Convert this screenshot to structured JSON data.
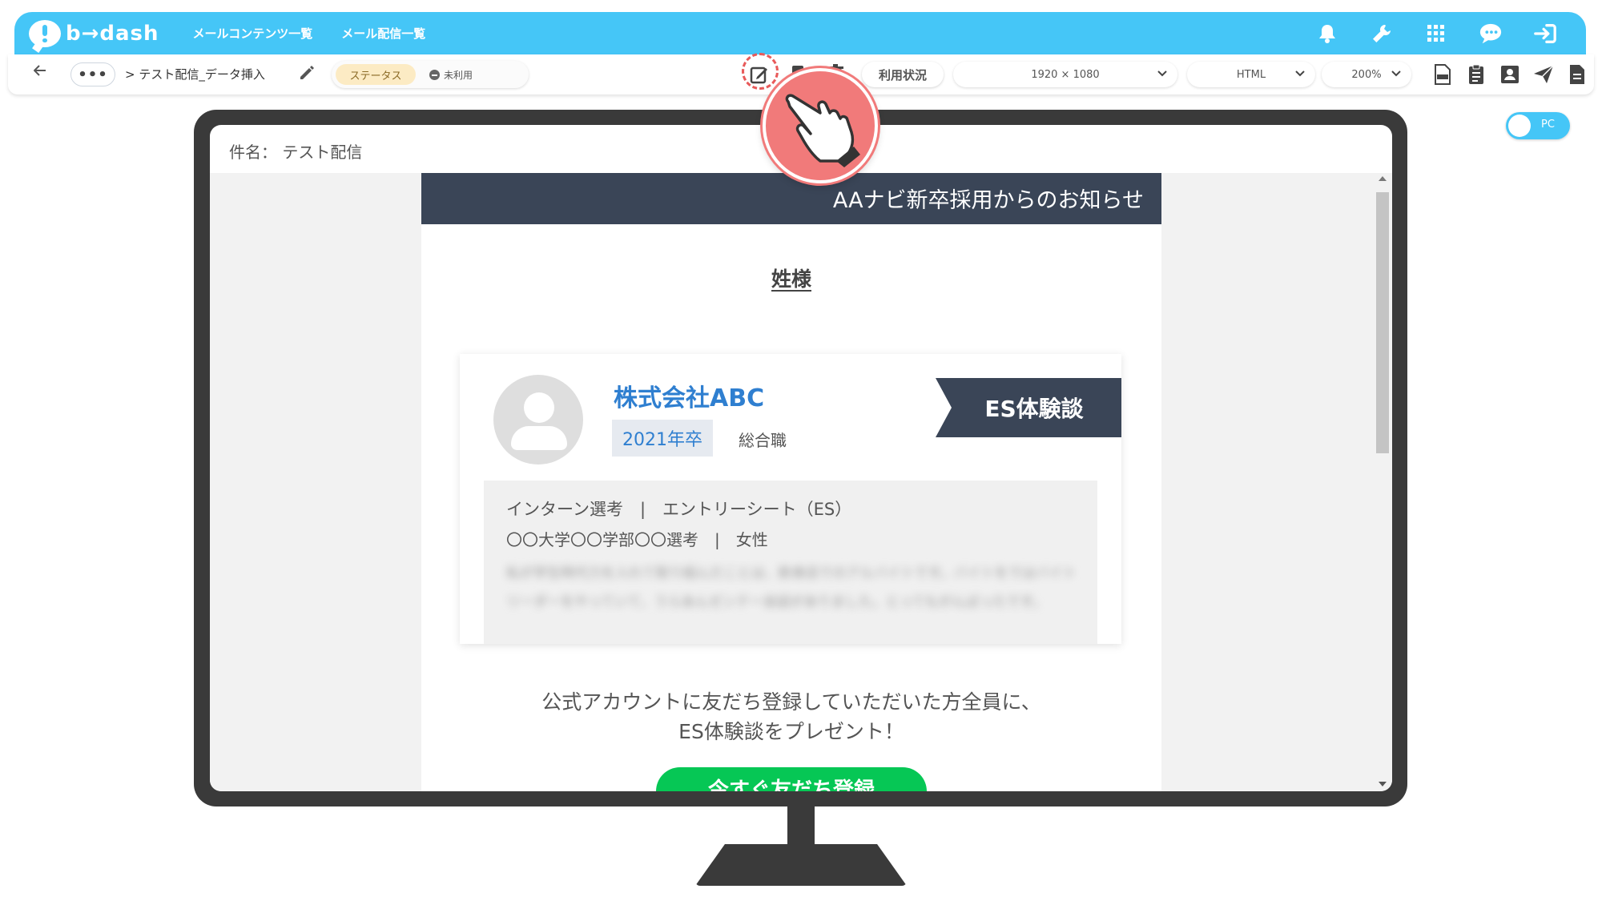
{
  "header": {
    "logo_text": "b→dash",
    "nav": [
      "メールコンテンツ一覧",
      "メール配信一覧"
    ],
    "icons": [
      "bell-icon",
      "wrench-icon",
      "apps-grid-icon",
      "chat-bubble-icon",
      "logout-icon"
    ]
  },
  "toolbar": {
    "dots_label": "•••",
    "breadcrumb": "> テスト配信_データ挿入",
    "status_label": "ステータス",
    "status_value": "未利用",
    "usage_label": "利用状況",
    "resolution": "1920 × 1080",
    "format": "HTML",
    "zoom": "200%",
    "right_icons": [
      "html-file-icon",
      "clipboard-icon",
      "contact-card-icon",
      "send-icon",
      "document-icon"
    ]
  },
  "view_toggle": {
    "label": "PC"
  },
  "preview": {
    "subject": "件名： テスト配信",
    "mail_header": "AAナビ新卒採用からのお知らせ",
    "greeting": "姓様",
    "card": {
      "company": "株式会社ABC",
      "year": "2021年卒",
      "job": "総合職",
      "ribbon": "ES体験談",
      "detail_line1": "インターン選考　|　エントリーシート（ES）",
      "detail_line2": "〇〇大学〇〇学部〇〇選考　|　女性",
      "blurred_text": "私が学生時代力を入れて取り組んだことは、飲食店でのアルバイトです。バイトをではバイトリーダーをやっていて、うらあんゼンテー会話がありました。とってもがんばったです。"
    },
    "promo_line1": "公式アカウントに友だち登録していただいた方全員に、",
    "promo_line2": "ES体験談をプレゼント！",
    "line_button": "今すぐ友だち登録"
  },
  "colors": {
    "header_bg": "#45c6f7",
    "mail_navy": "#3a4557",
    "company_blue": "#2f7fd0",
    "line_green": "#06c755",
    "pointer_red": "#f17a7a"
  }
}
